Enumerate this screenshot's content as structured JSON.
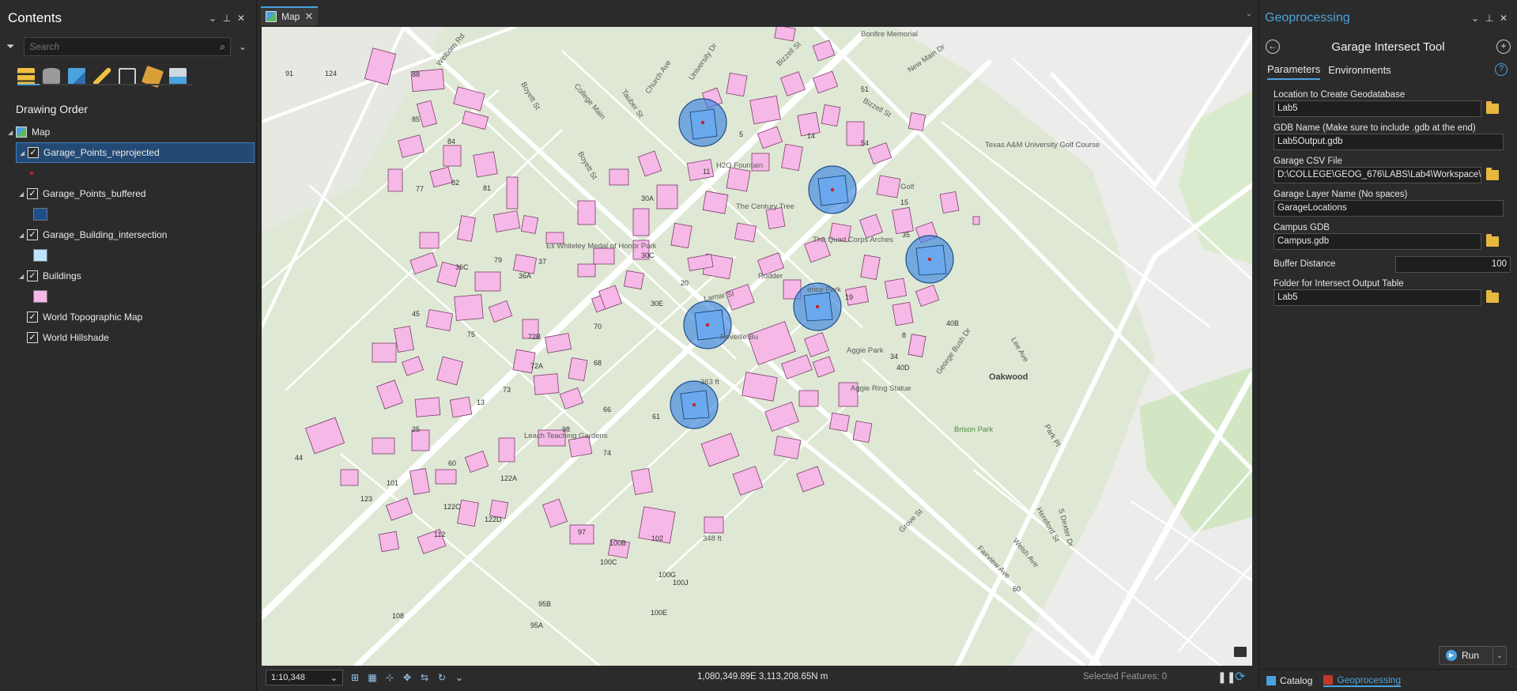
{
  "contents": {
    "title": "Contents",
    "search_placeholder": "Search",
    "section": "Drawing Order",
    "map_label": "Map",
    "layers": [
      {
        "name": "Garage_Points_reprojected",
        "swatch": "#cc2222",
        "selected": true
      },
      {
        "name": "Garage_Points_buffered",
        "swatch": "#1f4e8c"
      },
      {
        "name": "Garage_Building_intersection",
        "swatch": "#bfe3ff"
      },
      {
        "name": "Buildings",
        "swatch": "#f6b8e6"
      },
      {
        "name": "World Topographic Map"
      },
      {
        "name": "World Hillshade"
      }
    ]
  },
  "map": {
    "tab_label": "Map",
    "scale": "1:10,348",
    "coordinates": "1,080,349.89E 3,113,208.65N m",
    "selected_features": "Selected Features: 0",
    "labels": [
      "Welborn Rd",
      "Boyett St",
      "College Main",
      "Tauber St",
      "Church Ave",
      "University Dr",
      "Boyett St",
      "Bizzell St",
      "Bizzell St",
      "New Main Dr",
      "Bonfire Memorial",
      "Texas A&M University Golf Course",
      "Golf",
      "H2O Fountain",
      "The Century Tree",
      "The Quad Corps Arches",
      "Eli Whiteley Medal of Honor Park",
      "Lamar St",
      "Rudder",
      "Aggie Park",
      "Aggie Ring Statue",
      "George Bush Dr",
      "Lee Ave",
      "Oakwood",
      "Brison Park",
      "Park Pl",
      "Leach Teaching Gardens",
      "Hereford St",
      "Welsh Ave",
      "Fairview Ave",
      "Grove St",
      "S Dexter Dr",
      "Reveille Bu",
      "ence Park",
      "363 ft",
      "348 ft"
    ],
    "building_numbers": [
      "91",
      "124",
      "88",
      "85",
      "84",
      "82",
      "77",
      "81",
      "79",
      "37",
      "36C",
      "36A",
      "45",
      "75",
      "72B",
      "72A",
      "73",
      "70",
      "68",
      "66",
      "30A",
      "30C",
      "30E",
      "20",
      "11",
      "5",
      "14",
      "51",
      "54",
      "15",
      "35",
      "19",
      "40B",
      "40D",
      "8",
      "34",
      "61",
      "74",
      "98",
      "13",
      "25",
      "60",
      "44",
      "101",
      "122A",
      "123",
      "122C",
      "122D",
      "112",
      "97",
      "100B",
      "100C",
      "102",
      "100G",
      "100J",
      "100E",
      "95B",
      "95A",
      "108",
      "60"
    ]
  },
  "geoprocessing": {
    "title": "Geoprocessing",
    "tool": "Garage Intersect Tool",
    "tabs": [
      "Parameters",
      "Environments"
    ],
    "params": [
      {
        "label": "Location to Create Geodatabase",
        "value": "Lab5",
        "folder": true
      },
      {
        "label": "GDB Name (Make sure to include .gdb at the end)",
        "value": "Lab5Output.gdb",
        "folder": false
      },
      {
        "label": "Garage CSV File",
        "value": "D:\\COLLEGE\\GEOG_676\\LABS\\Lab4\\Workspace\\g",
        "folder": true
      },
      {
        "label": "Garage Layer Name (No spaces)",
        "value": "GarageLocations",
        "folder": false
      },
      {
        "label": "Campus GDB",
        "value": "Campus.gdb",
        "folder": true
      }
    ],
    "buffer": {
      "label": "Buffer Distance",
      "value": "100"
    },
    "output": {
      "label": "Folder for Intersect Output Table",
      "value": "Lab5"
    },
    "run_label": "Run",
    "bottom_tabs": [
      "Catalog",
      "Geoprocessing"
    ]
  },
  "colors": {
    "accent": "#4aa3df",
    "building": "#f6b8e6",
    "buffer": "#3a86e0",
    "map_bg": "#dfe8d4"
  }
}
